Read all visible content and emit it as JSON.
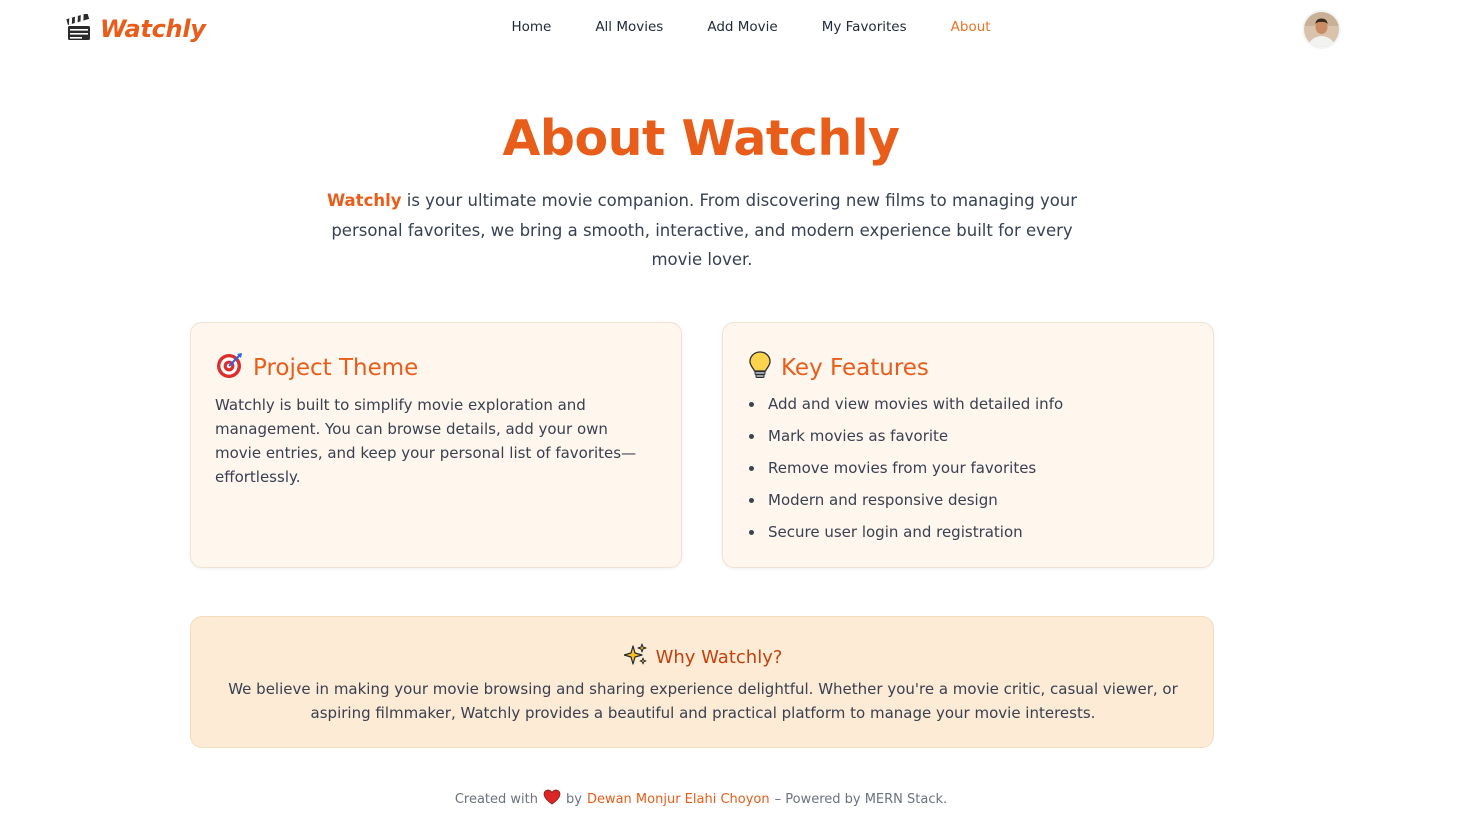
{
  "brand": {
    "name": "Watchly",
    "icon": "clapperboard-icon"
  },
  "nav": {
    "links": [
      {
        "label": "Home"
      },
      {
        "label": "All Movies"
      },
      {
        "label": "Add Movie"
      },
      {
        "label": "My Favorites"
      },
      {
        "label": "About"
      }
    ],
    "active": "About"
  },
  "user": {
    "avatar": "user-avatar"
  },
  "hero": {
    "title": "About Watchly",
    "intro_highlight": "Watchly",
    "intro_text": " is your ultimate movie companion. From discovering new films to managing your personal favorites, we bring a smooth, interactive, and modern experience built for every movie lover."
  },
  "theme_card": {
    "icon": "target-icon",
    "title": "Project Theme",
    "body": "Watchly is built to simplify movie exploration and management. You can browse details, add your own movie entries, and keep your personal list of favorites—effortlessly."
  },
  "features_card": {
    "icon": "lightbulb-icon",
    "title": "Key Features",
    "items": [
      "Add and view movies with detailed info",
      "Mark movies as favorite",
      "Remove movies from your favorites",
      "Modern and responsive design",
      "Secure user login and registration"
    ]
  },
  "why": {
    "icon": "sparkles-icon",
    "title": "Why Watchly?",
    "text": "We believe in making your movie browsing and sharing experience delightful. Whether you're a movie critic, casual viewer, or aspiring filmmaker, Watchly provides a beautiful and practical platform to manage your movie interests."
  },
  "footer": {
    "prefix": "Created with",
    "icon": "heart-icon",
    "by": "by",
    "author": "Dewan Monjur Elahi Choyon",
    "suffix": "– Powered by MERN Stack."
  },
  "colors": {
    "accent": "#e85d1a",
    "card_bg": "#fff6ee",
    "why_bg": "#fdebd5"
  }
}
